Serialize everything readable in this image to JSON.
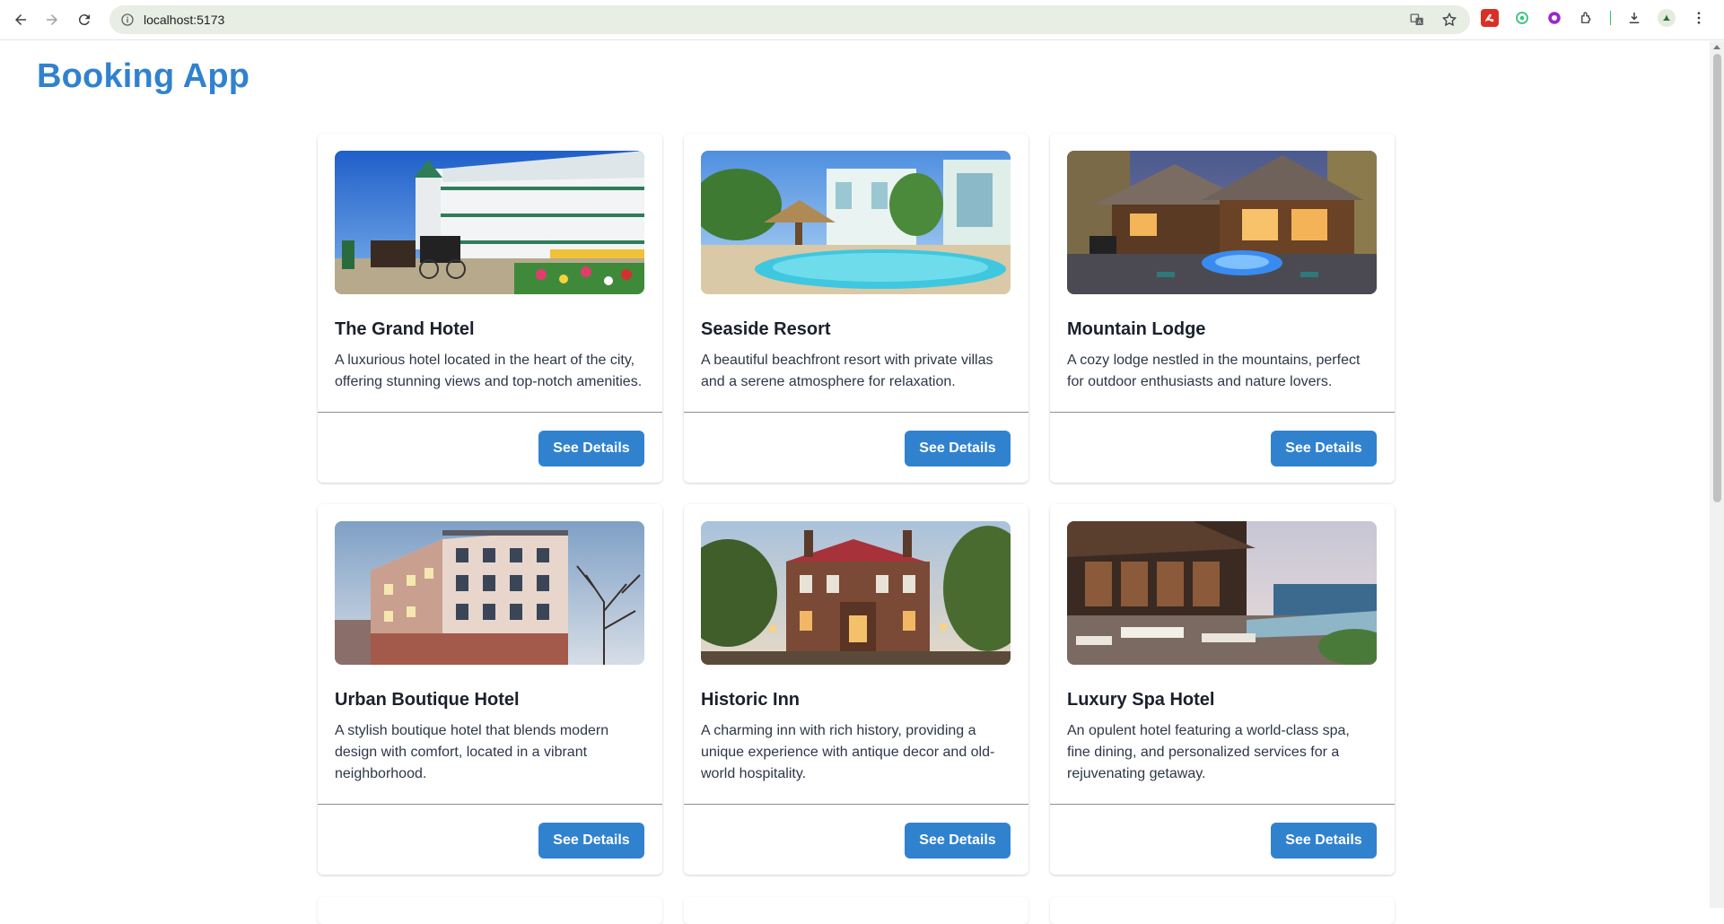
{
  "browser": {
    "url": "localhost:5173"
  },
  "app": {
    "title": "Booking App"
  },
  "hotels": [
    {
      "name": "The Grand Hotel",
      "description": "A luxurious hotel located in the heart of the city, offering stunning views and top-notch amenities.",
      "button_label": "See Details"
    },
    {
      "name": "Seaside Resort",
      "description": "A beautiful beachfront resort with private villas and a serene atmosphere for relaxation.",
      "button_label": "See Details"
    },
    {
      "name": "Mountain Lodge",
      "description": "A cozy lodge nestled in the mountains, perfect for outdoor enthusiasts and nature lovers.",
      "button_label": "See Details"
    },
    {
      "name": "Urban Boutique Hotel",
      "description": "A stylish boutique hotel that blends modern design with comfort, located in a vibrant neighborhood.",
      "button_label": "See Details"
    },
    {
      "name": "Historic Inn",
      "description": "A charming inn with rich history, providing a unique experience with antique decor and old-world hospitality.",
      "button_label": "See Details"
    },
    {
      "name": "Luxury Spa Hotel",
      "description": "An opulent hotel featuring a world-class spa, fine dining, and personalized services for a rejuvenating getaway.",
      "button_label": "See Details"
    }
  ],
  "colors": {
    "accent": "#3182ce",
    "title_text": "#1a202c",
    "body_text": "#2d3748"
  }
}
